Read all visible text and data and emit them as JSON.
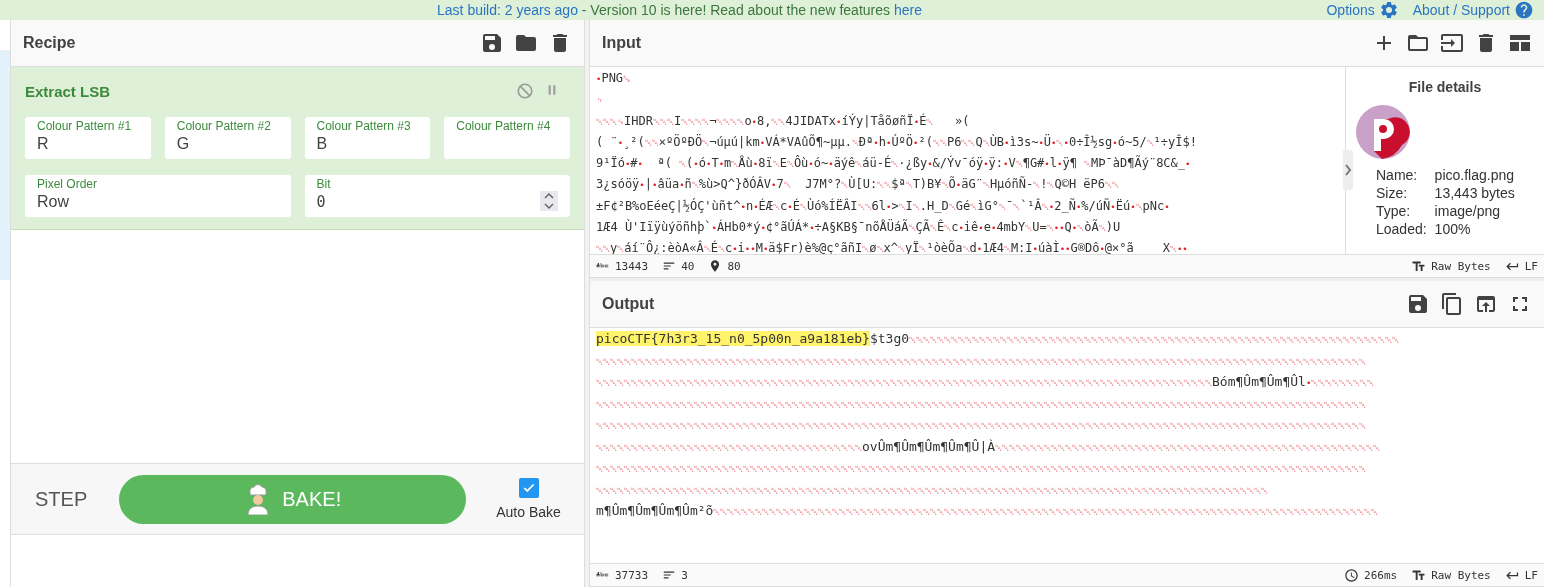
{
  "banner": {
    "build_link": "Last build: 2 years ago",
    "message": " - Version 10 is here! Read about the new features ",
    "here_link": "here",
    "links": [
      {
        "kind": "gear",
        "label": "Options"
      },
      {
        "kind": "help",
        "label": "About / Support"
      }
    ]
  },
  "recipe": {
    "title": "Recipe",
    "operation": {
      "name": "Extract LSB",
      "fields": [
        {
          "label": "Colour Pattern #1",
          "value": "R"
        },
        {
          "label": "Colour Pattern #2",
          "value": "G"
        },
        {
          "label": "Colour Pattern #3",
          "value": "B"
        },
        {
          "label": "Colour Pattern #4"
        }
      ],
      "fields_2": [
        {
          "label": "Pixel Order",
          "value": "Row",
          "kind": "text"
        },
        {
          "label": "Bit",
          "value": "0",
          "kind": "number"
        }
      ]
    }
  },
  "bake": {
    "step": "STEP",
    "bake": "BAKE!",
    "auto_bake": {
      "label": "Auto Bake",
      "checked": true
    }
  },
  "input": {
    "title": "Input",
    "lines": [
      "•PNG␚",
      "␊",
      "␀␀␀␍IHDR␀␀␀I␀␀␀␀¬␀␀␀␀o•8,␀␀4JIDATx•íÝy|TåõøñÏ•É␀   »(",
      "( ¨•¸²(␀␀×ºÖºÐÖ␀¬úµú|km•VÁ*VAûÕ¶~µµ.␀Ðª•h•ÚºÖ•²(␀␀P6␀␀Q␀ÙB•ì3s~•Ü•␀•0÷Î½sg•ó~5/␀¹÷yÎ$!",
      "9¹Ïó•#•  ª( ␀(•ó•T•m␀Åù•8ï␀E␀Ôù•ó~•äýê␀áü-É␀·¿ßy•&/Ýv¯óÿ•ÿ:•V␀¶G#•l•ÿ¶ ␀MÞ¯àD¶Ãý¨8C&_•",
      "3¿sóöÿ•|•âüa•ñ␀%ù>Q^}ðÓÂV•7␀  J7M°?␀Ù[U:␀␀$ª␀T)B¥␀Õ•äG¨␀HµóñÑ-␀!␀Q©H ëP6␀␀",
      "±F¢²B%oEéeÇ|½ÓÇ'ùñt^•n•ÉÆ␀c•É␀Ùó%ÍËÂI␀␀6l•>␀I␀.H_D␀Gé␀ìG°␀¯␀`¹Â␀•2_Ñ•%/úÑ•Ëú•␀pNc•",
      "1Æ4 Ù'Iïÿùýöñhþ`•ÁHb0*ý•¢°ãÚÁ*•÷A§KB§¯nõÅÜáÃ␀ÇÃ␀Ê␀c•iê•e•4mbY␀U=␀••Q•␀òÃ␀)U",
      "␀␀y␀áí¨Ô¿:èòA«Â␀É␀c•i••M•ä$Fr)è%@ç°ãñI␀ø␀x^␀yÏ␀¹òèÕa␀d•1Æ4␀M:I•úàÌ••G®Dô•@×°ã    X␀••"
    ],
    "status": [
      {
        "kind": "length",
        "text": "13443"
      },
      {
        "kind": "lines",
        "text": "40"
      },
      {
        "kind": "position",
        "text": "80"
      }
    ],
    "controls": [
      {
        "kind": "format",
        "text": "Raw Bytes"
      },
      {
        "kind": "eol",
        "text": "LF"
      }
    ],
    "file_details": {
      "title": "File details",
      "rows": [
        {
          "key": "Name:",
          "value": "pico.flag.png"
        },
        {
          "key": "Size:",
          "value": "13,443 bytes"
        },
        {
          "key": "Type:",
          "value": "image/png"
        },
        {
          "key": "Loaded:",
          "value": "100%"
        }
      ]
    }
  },
  "output": {
    "title": "Output",
    "highlight": "picoCTF{7h3r3_15_n0_5p00n_a9a181eb}",
    "after_highlight": "$t3g0",
    "lines": [
      "␀␀␀␀␀␀␀␀␀␀␀␀␀␀␀␀␀␀␀␀␀␀␀␀␀␀␀␀␀␀␀␀␀␀␀␀␀␀␀␀␀␀␀␀␀␀␀␀␀␀␀␀␀␀␀␀␀␀␀␀␀␀␀␀␀␀␀␀␀␀",
      "␀␀␀␀␀␀␀␀␀␀␀␀␀␀␀␀␀␀␀␀␀␀␀␀␀␀␀␀␀␀␀␀␀␀␀␀␀␀␀␀␀␀␀␀␀␀␀␀␀␀␀␀␀␀␀␀␀␀␀␀␀␀␀␀␀␀␀␀␀␀␀␀␀␀␀␀␀␀␀␀␀␀␀␀␀␀␀␀␀␀␀␀␀␀␀␀␀␀␀␀␀␀␀␀␀␀␀␀␀␀",
      "␀␀␀␀␀␀␀␀␀␀␀␀␀␀␀␀␀␀␀␀␀␀␀␀␀␀␀␀␀␀␀␀␀␀␀␀␀␀␀␀␀␀␀␀␀␀␀␀␀␀␀␀␀␀␀␀␀␀␀␀␀␀␀␀␀␀␀␀␀␀␀␀␀␀␀␀␀␀␀␀␀␀␀␀␀␀␀␀Bóm¶Ûm¶Ûm¶Ûl•␀␀␀␀␀␀␀␀␀",
      "␀␀␀␀␀␀␀␀␀␀␀␀␀␀␀␀␀␀␀␀␀␀␀␀␀␀␀␀␀␀␀␀␀␀␀␀␀␀␀␀␀␀␀␀␀␀␀␀␀␀␀␀␀␀␀␀␀␀␀␀␀␀␀␀␀␀␀␀␀␀␀␀␀␀␀␀␀␀␀␀␀␀␀␀␀␀␀␀␀␀␀␀␀␀␀␀␀␀␀␀␀␀␀␀␀␀␀␀␀␀",
      "␀␀␀␀␀␀␀␀␀␀␀␀␀␀␀␀␀␀␀␀␀␀␀␀␀␀␀␀␀␀␀␀␀␀␀␀␀␀␀␀␀␀␀␀␀␀␀␀␀␀␀␀␀␀␀␀␀␀␀␀␀␀␀␀␀␀␀␀␀␀␀␀␀␀␀␀␀␀␀␀␀␀␀␀␀␀␀␀␀␀␀␀␀␀␀␀␀␀␀␀␀␀␀␀␀␀␀␀␀␀",
      "␀␀␀␀␀␀␀␀␀␀␀␀␀␀␀␀␀␀␀␀␀␀␀␀␀␀␀␀␀␀␀␀␀␀␀␀␀␀ovÛm¶Ûm¶Ûm¶Ûm¶Û|À␀␀␀␀␀␀␀␀␀␀␀␀␀␀␀␀␀␀␀␀␀␀␀␀␀␀␀␀␀␀␀␀␀␀␀␀␀␀␀␀␀␀␀␀␀␀␀␀␀␀␀␀␀␀␀",
      "␀␀␀␀␀␀␀␀␀␀␀␀␀␀␀␀␀␀␀␀␀␀␀␀␀␀␀␀␀␀␀␀␀␀␀␀␀␀␀␀␀␀␀␀␀␀␀␀␀␀␀␀␀␀␀␀␀␀␀␀␀␀␀␀␀␀␀␀␀␀␀␀␀␀␀␀␀␀␀␀␀␀␀␀␀␀␀␀␀␀␀␀␀␀␀␀␀␀␀␀␀␀␀␀␀␀␀␀␀␀",
      "␀␀␀␀␀␀␀␀␀␀␀␀␀␀␀␀␀␀␀␀␀␀␀␀␀␀␀␀␀␀␀␀␀␀␀␀␀␀␀␀␀␀␀␀␀␀␀␀␀␀␀␀␀␀␀␀␀␀␀␀␀␀␀␀␀␀␀␀␀␀␀␀␀␀␀␀␀␀␀␀␀␀␀␀␀␀␀␀␀␀␀␀␀␀␀␀",
      "m¶Ûm¶Ûm¶Ûm¶Ûm²õ␀␀␀␀␀␀␀␀␀␀␀␀␀␀␀␀␀␀␀␀␀␀␀␀␀␀␀␀␀␀␀␀␀␀␀␀␀␀␀␀␀␀␀␀␀␀␀␀␀␀␀␀␀␀␀␀␀␀␀␀␀␀␀␀␀␀␀␀␀␀␀␀␀␀␀␀␀␀␀␀␀␀␀␀␀␀␀␀␀␀␀␀␀␀␀"
    ],
    "status": [
      {
        "kind": "length",
        "text": "37733"
      },
      {
        "kind": "lines",
        "text": "3"
      }
    ],
    "controls": [
      {
        "kind": "time",
        "text": "266ms"
      },
      {
        "kind": "format",
        "text": "Raw Bytes"
      },
      {
        "kind": "eol",
        "text": "LF"
      }
    ]
  }
}
